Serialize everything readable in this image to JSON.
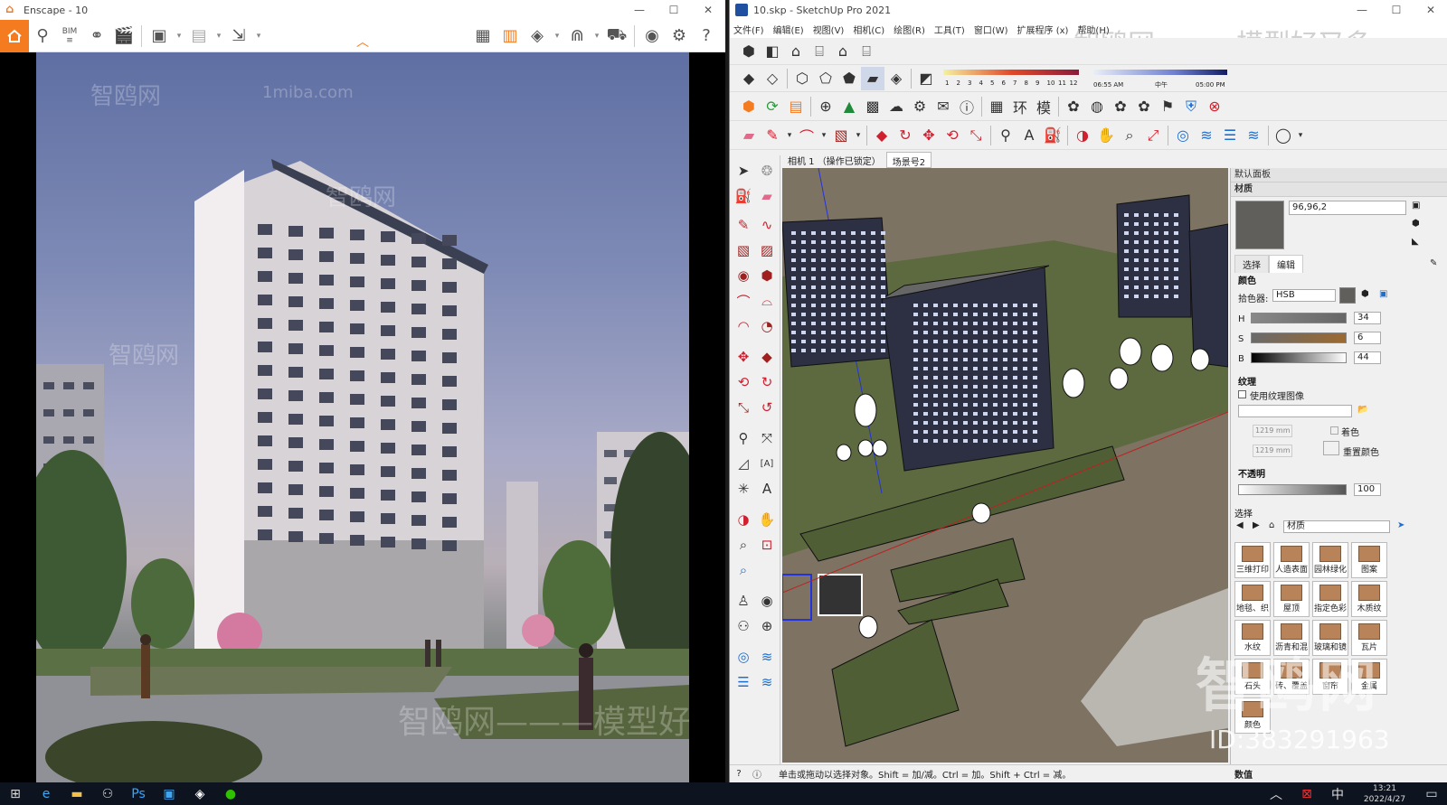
{
  "enscape": {
    "title": "Enscape - 10",
    "toolbar": {
      "bim": "BIM",
      "icons": [
        "home-icon",
        "locate-icon",
        "bim-icon",
        "binoculars-icon",
        "clapper-icon",
        "export-image-icon",
        "batch-render-icon",
        "export-exe-icon",
        "map-icon",
        "render-icon",
        "cube-icon",
        "material-icon",
        "asset-icon",
        "vr-icon",
        "settings-icon",
        "help-icon"
      ]
    },
    "render_watermarks": [
      "智鸥网",
      "1miba.com",
      "智鸥网———模型好又多———"
    ]
  },
  "sketchup": {
    "title": "10.skp - SketchUp Pro 2021",
    "menu": [
      "文件(F)",
      "编辑(E)",
      "视图(V)",
      "相机(C)",
      "绘图(R)",
      "工具(T)",
      "窗口(W)",
      "扩展程序 (x)",
      "帮助(H)"
    ],
    "shadow": {
      "numbers": [
        "1",
        "2",
        "3",
        "4",
        "5",
        "6",
        "7",
        "8",
        "9",
        "10",
        "11",
        "12"
      ],
      "time_start": "06:55 AM",
      "time_mid": "中午",
      "time_end": "05:00 PM"
    },
    "scene_tabs": [
      "相机 1 （操作已锁定）",
      "场景号2"
    ],
    "watermark": "智鸥网———模型好又多",
    "status_text": "单击或拖动以选择对象。Shift = 加/减。Ctrl = 加。Shift + Ctrl = 减。",
    "value_label": "数值",
    "panel": {
      "title": "默认面板",
      "section": "材质",
      "material_name": "96,96,2",
      "tabs": [
        "选择",
        "编辑"
      ],
      "color_label": "颜色",
      "picker_label": "拾色器:",
      "picker_value": "HSB",
      "h_label": "H",
      "h_value": "34",
      "s_label": "S",
      "s_value": "6",
      "b_label": "B",
      "b_value": "44",
      "texture_label": "纹理",
      "use_texture": "使用纹理图像",
      "tex_w": "1219 mm",
      "tex_h": "1219 mm",
      "colorize": "着色",
      "reset_color": "重置颜色",
      "opacity_label": "不透明",
      "opacity_value": "100",
      "select_label": "选择",
      "library": "材质",
      "materials": [
        "三维打印",
        "人造表面",
        "园林绿化",
        "图案",
        "地毯、织",
        "屋顶",
        "指定色彩",
        "木质纹",
        "水纹",
        "沥青和混",
        "玻璃和镜",
        "瓦片",
        "石头",
        "砖、覆盖",
        "窗帘",
        "金属",
        "颜色"
      ]
    },
    "id_watermark": "ID:383291963",
    "big_watermark": "智鸥网"
  },
  "taskbar": {
    "time": "13:21",
    "date": "2022/4/27",
    "lang": "中"
  },
  "colors": {
    "enscape_accent": "#f47b20",
    "su_blue": "#1f4fa0",
    "swatch": "#605f5c"
  }
}
